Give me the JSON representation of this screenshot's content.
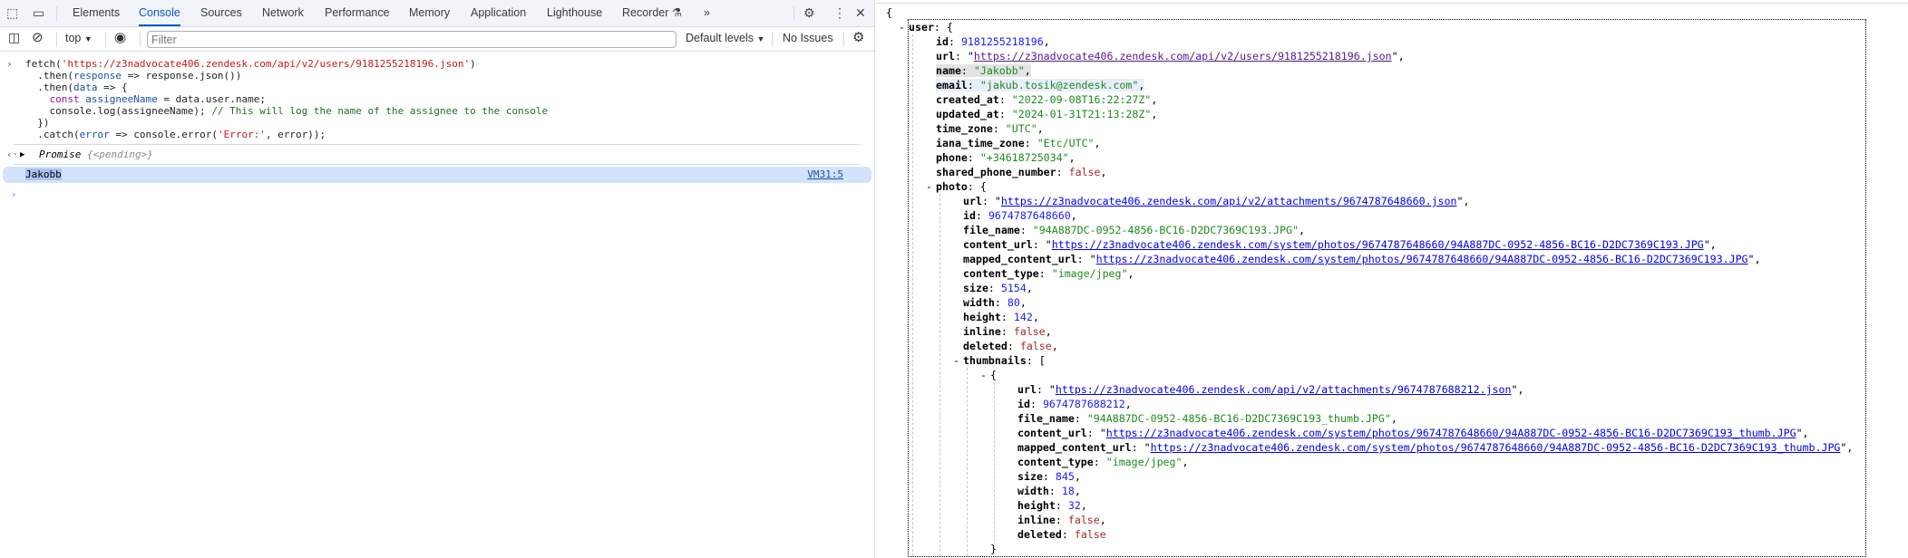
{
  "devtools": {
    "tabs": [
      "Elements",
      "Console",
      "Sources",
      "Network",
      "Performance",
      "Memory",
      "Application",
      "Lighthouse",
      "Recorder"
    ],
    "active_tab": "Console",
    "more_tabs": "»",
    "toolbar": {
      "context": "top",
      "filter_placeholder": "Filter",
      "levels": "Default levels",
      "issues": "No Issues"
    },
    "console": {
      "code_lines": [
        [
          [
            "p",
            "fetch("
          ],
          [
            "s",
            "'https://z3nadvocate406.zendesk.com/api/v2/users/9181255218196.json'"
          ],
          [
            "p",
            ")"
          ]
        ],
        [
          [
            "p",
            "  .then("
          ],
          [
            "v",
            "response"
          ],
          [
            "p",
            " => response.json())"
          ]
        ],
        [
          [
            "p",
            "  .then("
          ],
          [
            "v",
            "data"
          ],
          [
            "p",
            " => {"
          ]
        ],
        [
          [
            "p",
            "    "
          ],
          [
            "k",
            "const"
          ],
          [
            "p",
            " "
          ],
          [
            "v",
            "assigneeName"
          ],
          [
            "p",
            " = data.user.name;"
          ]
        ],
        [
          [
            "p",
            "    console.log(assigneeName); "
          ],
          [
            "c",
            "// This will log the name of the assignee to the console"
          ]
        ],
        [
          [
            "p",
            "  })"
          ]
        ],
        [
          [
            "p",
            "  .catch("
          ],
          [
            "v",
            "error"
          ],
          [
            "p",
            " => console.error("
          ],
          [
            "s",
            "'Error:'"
          ],
          [
            "p",
            ", error));"
          ]
        ]
      ],
      "result_label": "Promise",
      "result_state": "{<pending>}",
      "log_text": "Jakobb",
      "log_source": "VM31:5"
    }
  },
  "json_view": {
    "highlight": {
      "name": "gray",
      "email": "blue"
    },
    "visited_link": "https://z3nadvocate406.zendesk.com/api/v2/users/9181255218196.json",
    "data": {
      "user": {
        "id": 9181255218196,
        "url": "https://z3nadvocate406.zendesk.com/api/v2/users/9181255218196.json",
        "name": "Jakobb",
        "email": "jakub.tosik@zendesk.com",
        "created_at": "2022-09-08T16:22:27Z",
        "updated_at": "2024-01-31T21:13:28Z",
        "time_zone": "UTC",
        "iana_time_zone": "Etc/UTC",
        "phone": "+34618725034",
        "shared_phone_number": false,
        "photo": {
          "url": "https://z3nadvocate406.zendesk.com/api/v2/attachments/9674787648660.json",
          "id": 9674787648660,
          "file_name": "94A887DC-0952-4856-BC16-D2DC7369C193.JPG",
          "content_url": "https://z3nadvocate406.zendesk.com/system/photos/9674787648660/94A887DC-0952-4856-BC16-D2DC7369C193.JPG",
          "mapped_content_url": "https://z3nadvocate406.zendesk.com/system/photos/9674787648660/94A887DC-0952-4856-BC16-D2DC7369C193.JPG",
          "content_type": "image/jpeg",
          "size": 5154,
          "width": 80,
          "height": 142,
          "inline": false,
          "deleted": false,
          "thumbnails": [
            {
              "url": "https://z3nadvocate406.zendesk.com/api/v2/attachments/9674787688212.json",
              "id": 9674787688212,
              "file_name": "94A887DC-0952-4856-BC16-D2DC7369C193_thumb.JPG",
              "content_url": "https://z3nadvocate406.zendesk.com/system/photos/9674787648660/94A887DC-0952-4856-BC16-D2DC7369C193_thumb.JPG",
              "mapped_content_url": "https://z3nadvocate406.zendesk.com/system/photos/9674787648660/94A887DC-0952-4856-BC16-D2DC7369C193_thumb.JPG",
              "content_type": "image/jpeg",
              "size": 845,
              "width": 18,
              "height": 32,
              "inline": false,
              "deleted": false
            }
          ]
        }
      }
    }
  }
}
